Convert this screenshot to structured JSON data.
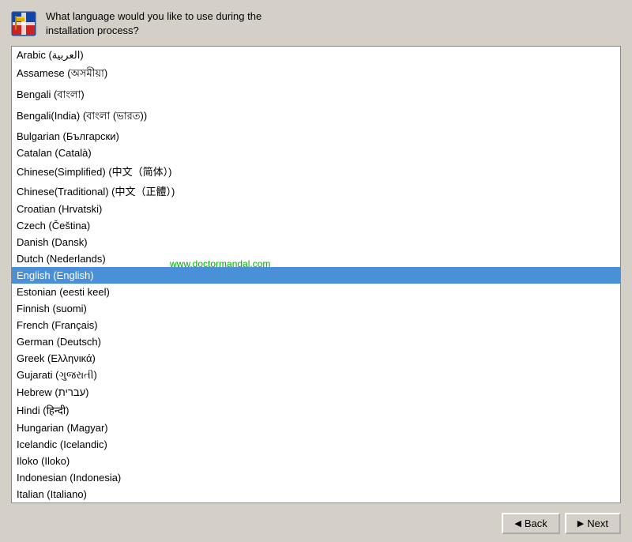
{
  "header": {
    "title_line1": "What language would you like to use during the",
    "title_line2": "installation process?"
  },
  "watermark": "www.doctormandal.com",
  "languages": [
    "Arabic (العربية)",
    "Assamese (অসমীয়া)",
    "Bengali (বাংলা)",
    "Bengali(India) (বাংলা (ভারত))",
    "Bulgarian (Български)",
    "Catalan (Català)",
    "Chinese(Simplified) (中文（简体）)",
    "Chinese(Traditional) (中文（正體）)",
    "Croatian (Hrvatski)",
    "Czech (Čeština)",
    "Danish (Dansk)",
    "Dutch (Nederlands)",
    "English (English)",
    "Estonian (eesti keel)",
    "Finnish (suomi)",
    "French (Français)",
    "German (Deutsch)",
    "Greek (Ελληνικά)",
    "Gujarati (ગુજરાતી)",
    "Hebrew (עברית)",
    "Hindi (हिन्दी)",
    "Hungarian (Magyar)",
    "Icelandic (Icelandic)",
    "Iloko (Iloko)",
    "Indonesian (Indonesia)",
    "Italian (Italiano)"
  ],
  "selected_index": 12,
  "buttons": {
    "back_label": "Back",
    "next_label": "Next"
  }
}
